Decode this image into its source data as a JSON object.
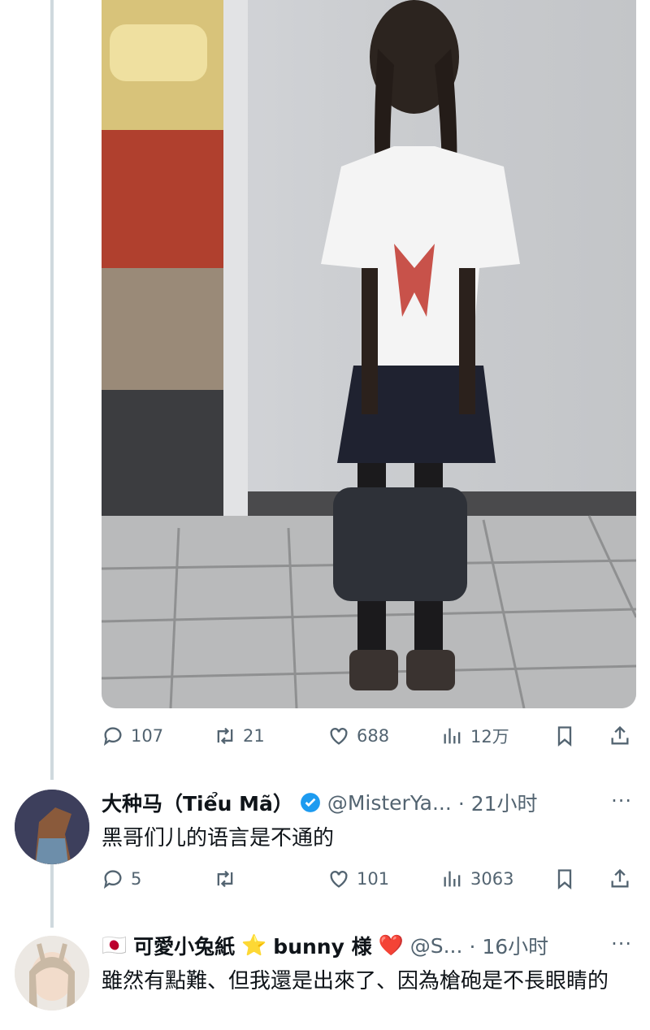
{
  "tweet1": {
    "actions": {
      "replies": "107",
      "retweets": "21",
      "likes": "688",
      "views": "12万"
    }
  },
  "reply1": {
    "display_name": "大种马（Tiểu Mã）",
    "handle": "@MisterYa...",
    "time": "· 21小时",
    "more": "···",
    "text": "黑哥们儿的语言是不通的",
    "actions": {
      "replies": "5",
      "retweets": "",
      "likes": "101",
      "views": "3063"
    }
  },
  "reply2": {
    "flag": "🇯🇵",
    "display_name_1": "可愛小兔紙",
    "star": "⭐",
    "display_name_2": "bunny 様",
    "heart": "❤️",
    "handle": "@S...",
    "time": "· 16小时",
    "more": "···",
    "text": "雖然有點難、但我還是出來了、因為槍砲是不長眼睛的"
  },
  "colors": {
    "verified": "#1d9bf0",
    "secondary_text": "#536471",
    "primary_text": "#0f1419",
    "thread_line": "#cfd9de"
  },
  "icons": [
    "reply-icon",
    "retweet-icon",
    "like-icon",
    "views-icon",
    "bookmark-icon",
    "share-icon",
    "verified-badge-icon",
    "more-icon"
  ]
}
